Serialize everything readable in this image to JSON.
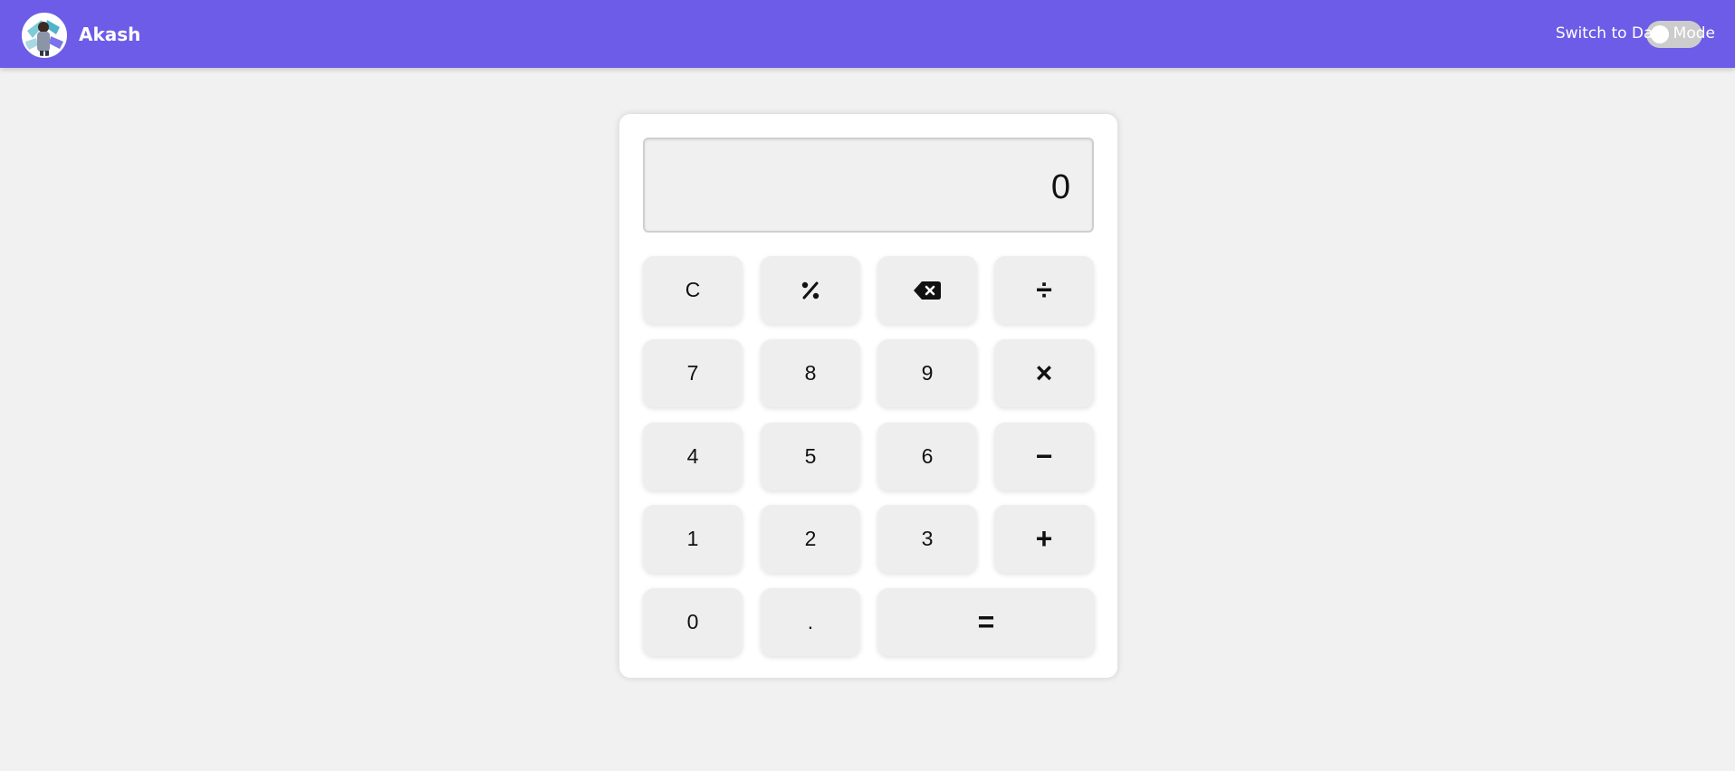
{
  "navbar": {
    "brand": "Akash",
    "toggle_label": "Switch to Dark Mode",
    "toggle_on": false,
    "background": "#6c5ce7"
  },
  "calculator": {
    "display_value": "0",
    "buttons": {
      "clear": "C",
      "percent": "%",
      "backspace_icon": "backspace-icon",
      "divide": "÷",
      "seven": "7",
      "eight": "8",
      "nine": "9",
      "multiply": "×",
      "four": "4",
      "five": "5",
      "six": "6",
      "minus": "−",
      "one": "1",
      "two": "2",
      "three": "3",
      "plus": "+",
      "zero": "0",
      "decimal": ".",
      "equals": "="
    }
  }
}
